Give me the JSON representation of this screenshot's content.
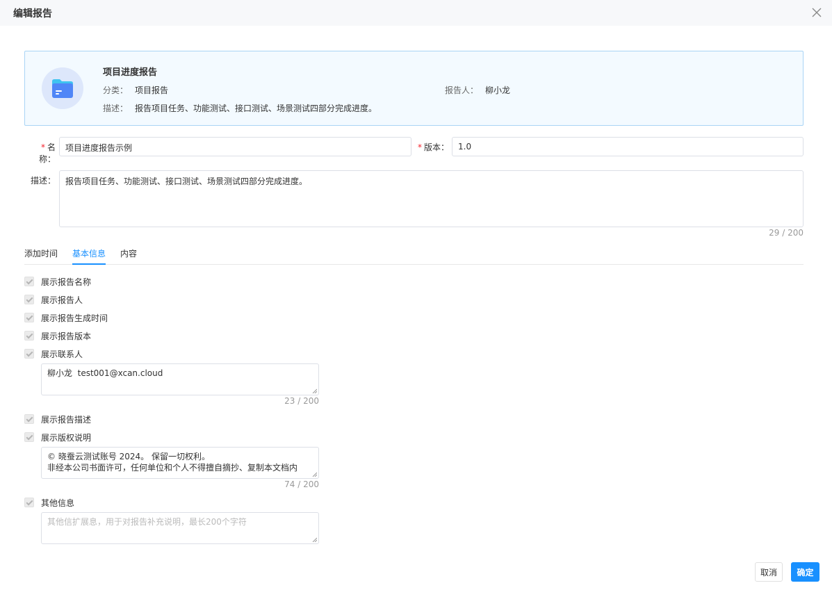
{
  "dialog": {
    "title": "编辑报告"
  },
  "card": {
    "title": "项目进度报告",
    "category_label": "分类：",
    "category_value": "项目报告",
    "reporter_label": "报告人：",
    "reporter_value": "柳小龙",
    "desc_label": "描述：",
    "desc_value": "报告项目任务、功能测试、接口测试、场景测试四部分完成进度。"
  },
  "form": {
    "name_label": "名称：",
    "name_value": "项目进度报告示例",
    "version_label": "版本：",
    "version_value": "1.0",
    "desc_label": "描述：",
    "desc_value": "报告项目任务、功能测试、接口测试、场景测试四部分完成进度。",
    "desc_counter": "29 / 200",
    "required_mark": "*"
  },
  "tabs": [
    {
      "label": "添加时间",
      "active": false
    },
    {
      "label": "基本信息",
      "active": true
    },
    {
      "label": "内容",
      "active": false
    }
  ],
  "options": {
    "show_name": "展示报告名称",
    "show_reporter": "展示报告人",
    "show_time": "展示报告生成时间",
    "show_version": "展示报告版本",
    "show_contact": "展示联系人",
    "contact_value": "柳小龙  test001@xcan.cloud",
    "contact_counter": "23 / 200",
    "show_desc": "展示报告描述",
    "show_copyright": "展示版权说明",
    "copyright_line1": "© 晓蚕云测试账号 2024。 保留一切权利。",
    "copyright_line2": "非经本公司书面许可，任何单位和个人不得擅自摘抄、复制本文档内",
    "copyright_counter": "74 / 200",
    "other_info": "其他信息",
    "other_placeholder": "其他信扩展息，用于对报告补充说明，最长200个字符"
  },
  "footer": {
    "cancel_label": "取消",
    "ok_label": "确定"
  },
  "colors": {
    "accent": "#1890ff",
    "required": "#f5222d",
    "card_border": "#a9d4f5"
  }
}
